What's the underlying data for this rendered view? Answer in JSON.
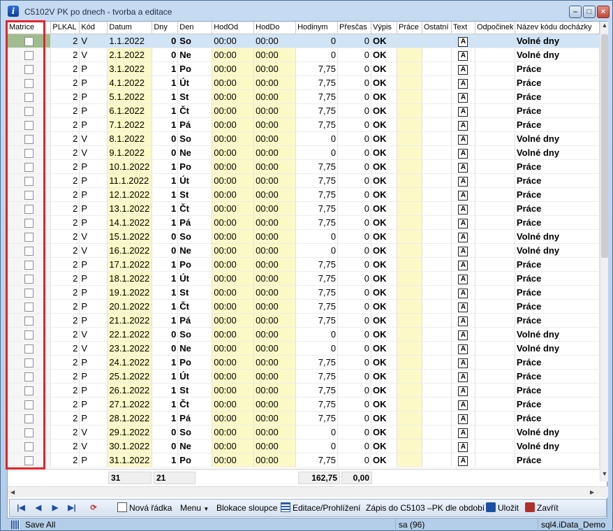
{
  "window": {
    "title": "C5102V PK po dnech - tvorba a editace",
    "min": "–",
    "max": "□",
    "close": "×"
  },
  "columns": [
    "Matrice",
    "PLKAL",
    "Kód",
    "Datum",
    "Dny",
    "Den",
    "HodOd",
    "HodDo",
    "Hodinym",
    "Přesčas",
    "Výpis",
    "Práce",
    "Ostatní",
    "Text",
    "Odpočinek",
    "Název kódu docházky"
  ],
  "rows": [
    {
      "plkal": "2",
      "kod": "V",
      "datum": "1.1.2022",
      "dny": "0",
      "den": "So",
      "od": "00:00",
      "do": "00:00",
      "hod": "0",
      "pre": "0",
      "vypis": "OK",
      "nazev": "Volné dny",
      "weekend": true
    },
    {
      "plkal": "2",
      "kod": "V",
      "datum": "2.1.2022",
      "dny": "0",
      "den": "Ne",
      "od": "00:00",
      "do": "00:00",
      "hod": "0",
      "pre": "0",
      "vypis": "OK",
      "nazev": "Volné dny",
      "weekend": true
    },
    {
      "plkal": "2",
      "kod": "P",
      "datum": "3.1.2022",
      "dny": "1",
      "den": "Po",
      "od": "00:00",
      "do": "00:00",
      "hod": "7,75",
      "pre": "0",
      "vypis": "OK",
      "nazev": "Práce",
      "weekend": false
    },
    {
      "plkal": "2",
      "kod": "P",
      "datum": "4.1.2022",
      "dny": "1",
      "den": "Út",
      "od": "00:00",
      "do": "00:00",
      "hod": "7,75",
      "pre": "0",
      "vypis": "OK",
      "nazev": "Práce",
      "weekend": false
    },
    {
      "plkal": "2",
      "kod": "P",
      "datum": "5.1.2022",
      "dny": "1",
      "den": "St",
      "od": "00:00",
      "do": "00:00",
      "hod": "7,75",
      "pre": "0",
      "vypis": "OK",
      "nazev": "Práce",
      "weekend": false
    },
    {
      "plkal": "2",
      "kod": "P",
      "datum": "6.1.2022",
      "dny": "1",
      "den": "Čt",
      "od": "00:00",
      "do": "00:00",
      "hod": "7,75",
      "pre": "0",
      "vypis": "OK",
      "nazev": "Práce",
      "weekend": false
    },
    {
      "plkal": "2",
      "kod": "P",
      "datum": "7.1.2022",
      "dny": "1",
      "den": "Pá",
      "od": "00:00",
      "do": "00:00",
      "hod": "7,75",
      "pre": "0",
      "vypis": "OK",
      "nazev": "Práce",
      "weekend": false
    },
    {
      "plkal": "2",
      "kod": "V",
      "datum": "8.1.2022",
      "dny": "0",
      "den": "So",
      "od": "00:00",
      "do": "00:00",
      "hod": "0",
      "pre": "0",
      "vypis": "OK",
      "nazev": "Volné dny",
      "weekend": true
    },
    {
      "plkal": "2",
      "kod": "V",
      "datum": "9.1.2022",
      "dny": "0",
      "den": "Ne",
      "od": "00:00",
      "do": "00:00",
      "hod": "0",
      "pre": "0",
      "vypis": "OK",
      "nazev": "Volné dny",
      "weekend": true
    },
    {
      "plkal": "2",
      "kod": "P",
      "datum": "10.1.2022",
      "dny": "1",
      "den": "Po",
      "od": "00:00",
      "do": "00:00",
      "hod": "7,75",
      "pre": "0",
      "vypis": "OK",
      "nazev": "Práce",
      "weekend": false
    },
    {
      "plkal": "2",
      "kod": "P",
      "datum": "11.1.2022",
      "dny": "1",
      "den": "Út",
      "od": "00:00",
      "do": "00:00",
      "hod": "7,75",
      "pre": "0",
      "vypis": "OK",
      "nazev": "Práce",
      "weekend": false
    },
    {
      "plkal": "2",
      "kod": "P",
      "datum": "12.1.2022",
      "dny": "1",
      "den": "St",
      "od": "00:00",
      "do": "00:00",
      "hod": "7,75",
      "pre": "0",
      "vypis": "OK",
      "nazev": "Práce",
      "weekend": false
    },
    {
      "plkal": "2",
      "kod": "P",
      "datum": "13.1.2022",
      "dny": "1",
      "den": "Čt",
      "od": "00:00",
      "do": "00:00",
      "hod": "7,75",
      "pre": "0",
      "vypis": "OK",
      "nazev": "Práce",
      "weekend": false
    },
    {
      "plkal": "2",
      "kod": "P",
      "datum": "14.1.2022",
      "dny": "1",
      "den": "Pá",
      "od": "00:00",
      "do": "00:00",
      "hod": "7,75",
      "pre": "0",
      "vypis": "OK",
      "nazev": "Práce",
      "weekend": false
    },
    {
      "plkal": "2",
      "kod": "V",
      "datum": "15.1.2022",
      "dny": "0",
      "den": "So",
      "od": "00:00",
      "do": "00:00",
      "hod": "0",
      "pre": "0",
      "vypis": "OK",
      "nazev": "Volné dny",
      "weekend": true
    },
    {
      "plkal": "2",
      "kod": "V",
      "datum": "16.1.2022",
      "dny": "0",
      "den": "Ne",
      "od": "00:00",
      "do": "00:00",
      "hod": "0",
      "pre": "0",
      "vypis": "OK",
      "nazev": "Volné dny",
      "weekend": true
    },
    {
      "plkal": "2",
      "kod": "P",
      "datum": "17.1.2022",
      "dny": "1",
      "den": "Po",
      "od": "00:00",
      "do": "00:00",
      "hod": "7,75",
      "pre": "0",
      "vypis": "OK",
      "nazev": "Práce",
      "weekend": false
    },
    {
      "plkal": "2",
      "kod": "P",
      "datum": "18.1.2022",
      "dny": "1",
      "den": "Út",
      "od": "00:00",
      "do": "00:00",
      "hod": "7,75",
      "pre": "0",
      "vypis": "OK",
      "nazev": "Práce",
      "weekend": false
    },
    {
      "plkal": "2",
      "kod": "P",
      "datum": "19.1.2022",
      "dny": "1",
      "den": "St",
      "od": "00:00",
      "do": "00:00",
      "hod": "7,75",
      "pre": "0",
      "vypis": "OK",
      "nazev": "Práce",
      "weekend": false
    },
    {
      "plkal": "2",
      "kod": "P",
      "datum": "20.1.2022",
      "dny": "1",
      "den": "Čt",
      "od": "00:00",
      "do": "00:00",
      "hod": "7,75",
      "pre": "0",
      "vypis": "OK",
      "nazev": "Práce",
      "weekend": false
    },
    {
      "plkal": "2",
      "kod": "P",
      "datum": "21.1.2022",
      "dny": "1",
      "den": "Pá",
      "od": "00:00",
      "do": "00:00",
      "hod": "7,75",
      "pre": "0",
      "vypis": "OK",
      "nazev": "Práce",
      "weekend": false
    },
    {
      "plkal": "2",
      "kod": "V",
      "datum": "22.1.2022",
      "dny": "0",
      "den": "So",
      "od": "00:00",
      "do": "00:00",
      "hod": "0",
      "pre": "0",
      "vypis": "OK",
      "nazev": "Volné dny",
      "weekend": true
    },
    {
      "plkal": "2",
      "kod": "V",
      "datum": "23.1.2022",
      "dny": "0",
      "den": "Ne",
      "od": "00:00",
      "do": "00:00",
      "hod": "0",
      "pre": "0",
      "vypis": "OK",
      "nazev": "Volné dny",
      "weekend": true
    },
    {
      "plkal": "2",
      "kod": "P",
      "datum": "24.1.2022",
      "dny": "1",
      "den": "Po",
      "od": "00:00",
      "do": "00:00",
      "hod": "7,75",
      "pre": "0",
      "vypis": "OK",
      "nazev": "Práce",
      "weekend": false
    },
    {
      "plkal": "2",
      "kod": "P",
      "datum": "25.1.2022",
      "dny": "1",
      "den": "Út",
      "od": "00:00",
      "do": "00:00",
      "hod": "7,75",
      "pre": "0",
      "vypis": "OK",
      "nazev": "Práce",
      "weekend": false
    },
    {
      "plkal": "2",
      "kod": "P",
      "datum": "26.1.2022",
      "dny": "1",
      "den": "St",
      "od": "00:00",
      "do": "00:00",
      "hod": "7,75",
      "pre": "0",
      "vypis": "OK",
      "nazev": "Práce",
      "weekend": false
    },
    {
      "plkal": "2",
      "kod": "P",
      "datum": "27.1.2022",
      "dny": "1",
      "den": "Čt",
      "od": "00:00",
      "do": "00:00",
      "hod": "7,75",
      "pre": "0",
      "vypis": "OK",
      "nazev": "Práce",
      "weekend": false
    },
    {
      "plkal": "2",
      "kod": "P",
      "datum": "28.1.2022",
      "dny": "1",
      "den": "Pá",
      "od": "00:00",
      "do": "00:00",
      "hod": "7,75",
      "pre": "0",
      "vypis": "OK",
      "nazev": "Práce",
      "weekend": false
    },
    {
      "plkal": "2",
      "kod": "V",
      "datum": "29.1.2022",
      "dny": "0",
      "den": "So",
      "od": "00:00",
      "do": "00:00",
      "hod": "0",
      "pre": "0",
      "vypis": "OK",
      "nazev": "Volné dny",
      "weekend": true
    },
    {
      "plkal": "2",
      "kod": "V",
      "datum": "30.1.2022",
      "dny": "0",
      "den": "Ne",
      "od": "00:00",
      "do": "00:00",
      "hod": "0",
      "pre": "0",
      "vypis": "OK",
      "nazev": "Volné dny",
      "weekend": true
    },
    {
      "plkal": "2",
      "kod": "P",
      "datum": "31.1.2022",
      "dny": "1",
      "den": "Po",
      "od": "00:00",
      "do": "00:00",
      "hod": "7,75",
      "pre": "0",
      "vypis": "OK",
      "nazev": "Práce",
      "weekend": false
    }
  ],
  "footer": {
    "count": "31",
    "dny": "21",
    "hodiny": "162,75",
    "prescas": "0,00"
  },
  "toolbar": {
    "new_row": "Nová řádka",
    "menu": "Menu",
    "block_columns": "Blokace sloupce",
    "edit_view": "Editace/Prohlížení",
    "write": "Zápis do C5103 –PK dle období",
    "save": "Uložit",
    "close": "Zavřít"
  },
  "status": {
    "save_all": "Save All",
    "user": "sa (96)",
    "server": "sql4.iData_Demo"
  },
  "colors": {
    "weekend": "#fbf9c6",
    "selected": "#d1e4f6",
    "highlight": "#e0262b"
  }
}
